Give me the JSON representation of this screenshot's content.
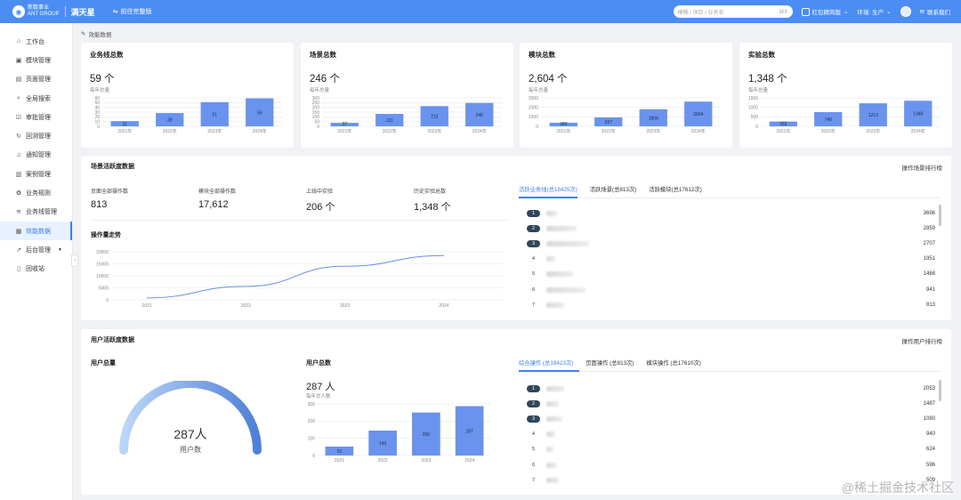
{
  "topbar": {
    "logo_line1": "新数事业",
    "logo_line2": "ANT GROUP",
    "app_name": "满天星",
    "full_link": "前往完整版",
    "search_placeholder": "模糊 / 项目 / 业务名",
    "search_shortcut": "⌘K",
    "workspace": "红包精简版",
    "env": "环境: 生产",
    "contact": "联系我们",
    "accent_color": "#4b8df3"
  },
  "sidebar": {
    "items": [
      {
        "label": "工作台",
        "icon": "home-icon"
      },
      {
        "label": "模块管理",
        "icon": "module-icon"
      },
      {
        "label": "页面管理",
        "icon": "page-icon"
      },
      {
        "label": "全局搜索",
        "icon": "search-icon"
      },
      {
        "label": "审批管理",
        "icon": "approve-icon"
      },
      {
        "label": "回测管理",
        "icon": "refresh-icon"
      },
      {
        "label": "通知管理",
        "icon": "bell-icon"
      },
      {
        "label": "案例管理",
        "icon": "case-icon"
      },
      {
        "label": "业务规则",
        "icon": "gear-icon"
      },
      {
        "label": "业务线管理",
        "icon": "layers-icon"
      },
      {
        "label": "效能数据",
        "icon": "chart-icon",
        "active": true
      },
      {
        "label": "后台管理",
        "icon": "trend-icon",
        "caret": true
      },
      {
        "label": "回收站",
        "icon": "trash-icon"
      }
    ]
  },
  "breadcrumb": "效能数据",
  "stat_cards": [
    {
      "title": "业务线总数",
      "value": "59 个",
      "sub": "每年总量",
      "chart": {
        "categories": [
          "2021年",
          "2022年",
          "2023年",
          "2024年"
        ],
        "values": [
          11,
          28,
          51,
          59
        ],
        "ticks": [
          0,
          10,
          20,
          30,
          40,
          50,
          60
        ],
        "ymax": 60
      }
    },
    {
      "title": "场景总数",
      "value": "246 个",
      "sub": "每年总量",
      "chart": {
        "categories": [
          "2021年",
          "2022年",
          "2023年",
          "2024年"
        ],
        "values": [
          37,
          131,
          213,
          246
        ],
        "ticks": [
          0,
          50,
          100,
          150,
          200,
          250,
          300
        ],
        "ymax": 300
      }
    },
    {
      "title": "模块总数",
      "value": "2,604 个",
      "sub": "每年总量",
      "chart": {
        "categories": [
          "2021年",
          "2022年",
          "2023年",
          "2024年"
        ],
        "values": [
          380,
          937,
          1804,
          2604
        ],
        "ticks": [
          0,
          1000,
          2000,
          3000
        ],
        "ymax": 3000
      }
    },
    {
      "title": "实验总数",
      "value": "1,348 个",
      "sub": "每年总量",
      "chart": {
        "categories": [
          "2021年",
          "2022年",
          "2023年",
          "2024年"
        ],
        "values": [
          252,
          748,
          1213,
          1348
        ],
        "ticks": [
          0,
          500,
          1000,
          1500
        ],
        "ymax": 1500
      }
    }
  ],
  "scene_activity": {
    "title": "场景活跃度数据",
    "link": "操作场景排行榜",
    "metrics": [
      {
        "label": "页面全部操作数",
        "value": "813"
      },
      {
        "label": "模块全部操作数",
        "value": "17,612"
      },
      {
        "label": "上线中实验",
        "value": "206 个"
      },
      {
        "label": "历史实验总数",
        "value": "1,348 个"
      }
    ],
    "trend_title": "操作量走势",
    "trend_chart": {
      "type": "line",
      "x": [
        "2021",
        "2022",
        "2023",
        "2024"
      ],
      "ticks": [
        0,
        5000,
        10000,
        15000,
        20000
      ],
      "ymax": 20000,
      "values": [
        800,
        5600,
        14000,
        18425
      ]
    },
    "tabs": [
      "活跃业务线(总18425次)",
      "活跃场景(总813次)",
      "活跃模块(总17612次)"
    ],
    "ranking": [
      {
        "rank": "1",
        "value": "3696",
        "w": 12
      },
      {
        "rank": "2",
        "value": "2859",
        "w": 34
      },
      {
        "rank": "3",
        "value": "2707",
        "w": 48
      },
      {
        "rank": "4",
        "value": "1951",
        "w": 10
      },
      {
        "rank": "5",
        "value": "1468",
        "w": 30
      },
      {
        "rank": "6",
        "value": "941",
        "w": 44
      },
      {
        "rank": "7",
        "value": "813",
        "w": 20
      }
    ]
  },
  "user_activity": {
    "title": "用户活跃度数据",
    "link": "操作用户排行榜",
    "total_title": "用户总量",
    "gauge_value": "287人",
    "gauge_label": "用户数",
    "count_title": "用户总数",
    "count_value": "287 人",
    "count_sub": "每年总人数",
    "chart": {
      "categories": [
        "2021",
        "2022",
        "2023",
        "2024"
      ],
      "values": [
        52,
        145,
        250,
        287
      ],
      "ticks": [
        0,
        100,
        200,
        300
      ],
      "ymax": 300
    },
    "tabs": [
      "综合操作 (总18423次)",
      "页面操作 (总813次)",
      "模块操作 (总17610次)"
    ],
    "ranking": [
      {
        "rank": "1",
        "value": "2053",
        "w": 20
      },
      {
        "rank": "2",
        "value": "1487",
        "w": 14
      },
      {
        "rank": "3",
        "value": "1080",
        "w": 18
      },
      {
        "rank": "4",
        "value": "940",
        "w": 10
      },
      {
        "rank": "5",
        "value": "624",
        "w": 8
      },
      {
        "rank": "6",
        "value": "596",
        "w": 12
      },
      {
        "rank": "7",
        "value": "509",
        "w": 14
      }
    ]
  },
  "watermark": "@稀土掘金技术社区",
  "colors": {
    "bar": "#6a93ee",
    "line": "#6a8de8",
    "badge": "#314659",
    "gauge_start": "#bcd6f7",
    "gauge_end": "#4f80d8"
  }
}
